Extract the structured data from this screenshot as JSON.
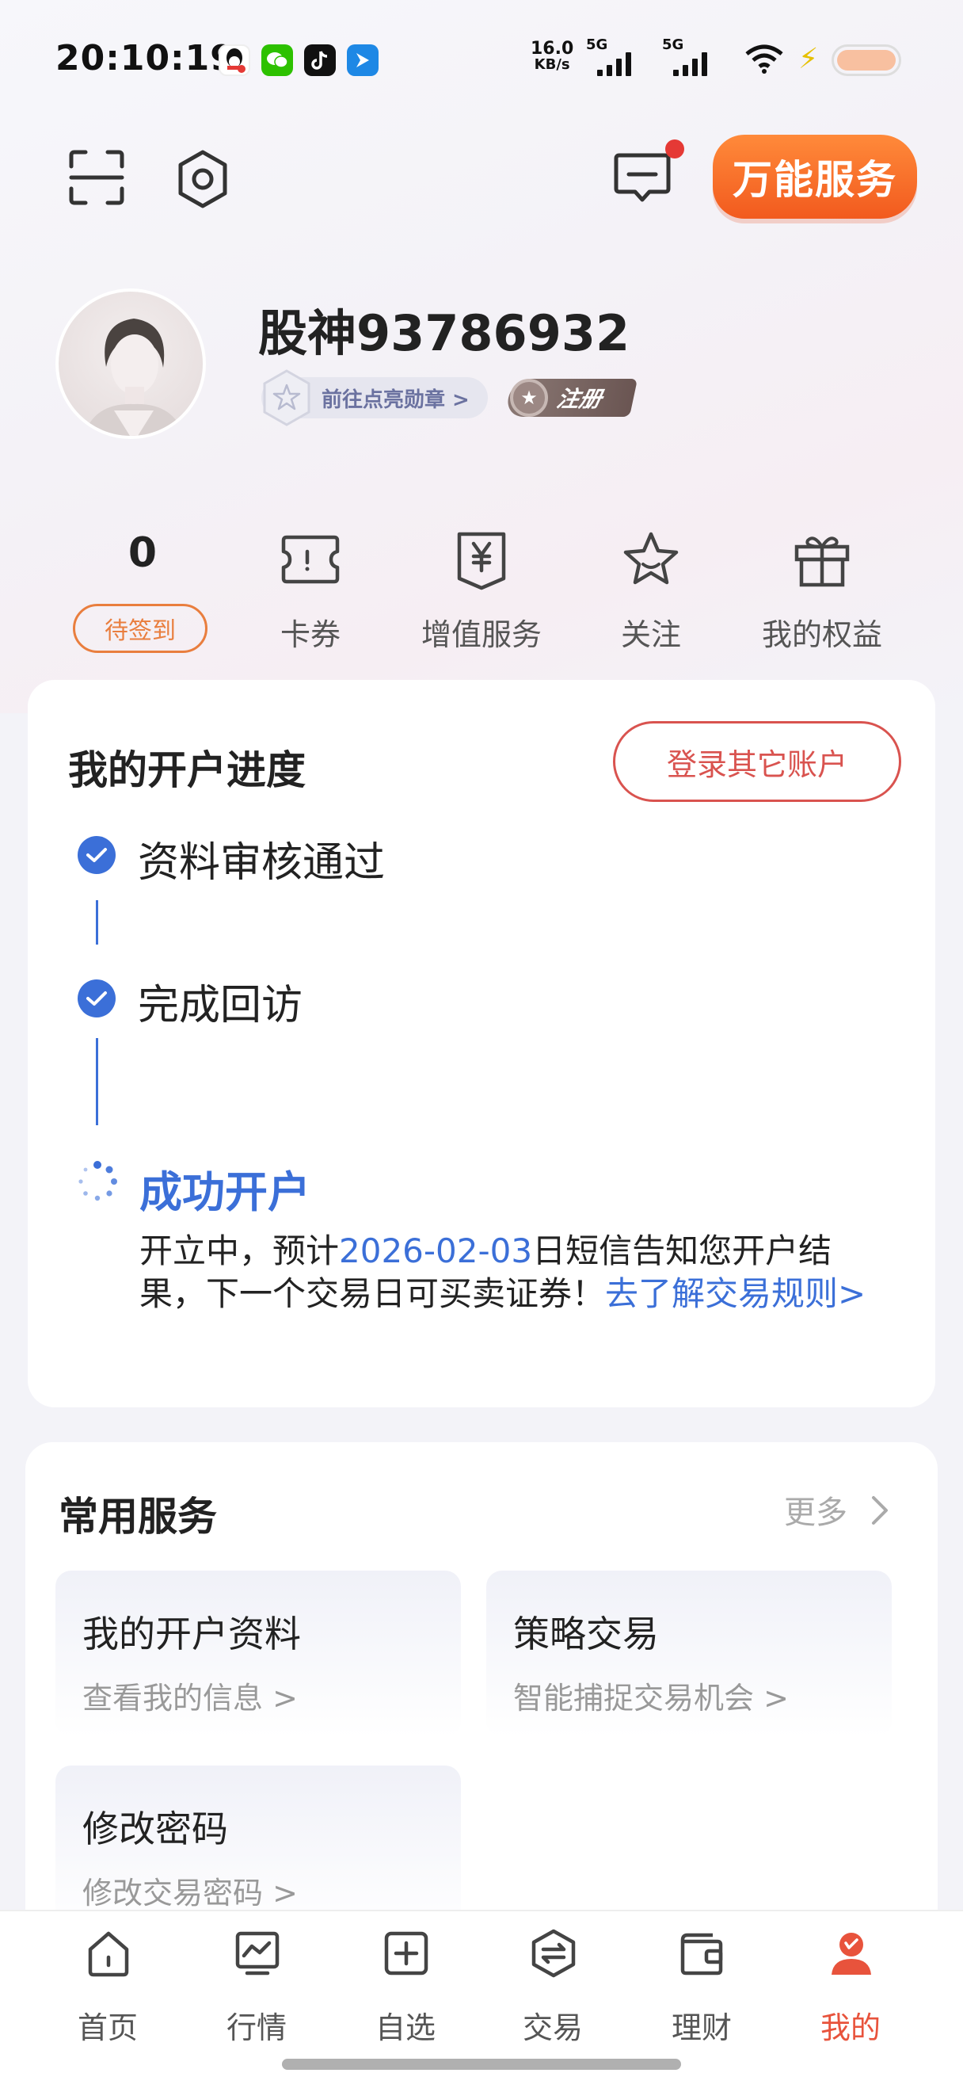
{
  "status_bar": {
    "time": "20:10:19",
    "net_speed_value": "16.0",
    "net_speed_unit": "KB/s",
    "sim1": "5G",
    "sim2": "5G"
  },
  "header": {
    "wanneng_label": "万能服务"
  },
  "profile": {
    "username": "股神93786932",
    "badge_link": "前往点亮勋章 >",
    "register_label": "注册"
  },
  "stats": {
    "checkin_count": "0",
    "checkin_button": "待签到",
    "items": [
      {
        "label": "卡券",
        "icon": "ticket-icon"
      },
      {
        "label": "增值服务",
        "icon": "yen-doc-icon"
      },
      {
        "label": "关注",
        "icon": "star-icon"
      },
      {
        "label": "我的权益",
        "icon": "gift-icon"
      }
    ]
  },
  "progress": {
    "title": "我的开户进度",
    "login_other": "登录其它账户",
    "steps": [
      {
        "label": "资料审核通过",
        "status": "done"
      },
      {
        "label": "完成回访",
        "status": "done"
      },
      {
        "label": "成功开户",
        "status": "in-progress"
      }
    ],
    "info_pre": "开立中，预计",
    "info_date": "2026-02-03",
    "info_mid": "日短信告知您开户结果，下一个交易日可买卖证券！",
    "info_link": "去了解交易规则>"
  },
  "services": {
    "title": "常用服务",
    "more": "更多",
    "items": [
      {
        "title": "我的开户资料",
        "subtitle": "查看我的信息 >"
      },
      {
        "title": "策略交易",
        "subtitle": "智能捕捉交易机会 >"
      },
      {
        "title": "修改密码",
        "subtitle": "修改交易密码 >"
      }
    ]
  },
  "bottom_nav": {
    "items": [
      {
        "label": "首页",
        "icon": "home-icon"
      },
      {
        "label": "行情",
        "icon": "chart-icon"
      },
      {
        "label": "自选",
        "icon": "add-box-icon"
      },
      {
        "label": "交易",
        "icon": "exchange-icon"
      },
      {
        "label": "理财",
        "icon": "wallet-icon"
      },
      {
        "label": "我的",
        "icon": "profile-icon",
        "active": true
      }
    ]
  },
  "colors": {
    "accent_blue": "#3b6fd8",
    "accent_red": "#e8533c",
    "orange": "#e97e3e"
  }
}
